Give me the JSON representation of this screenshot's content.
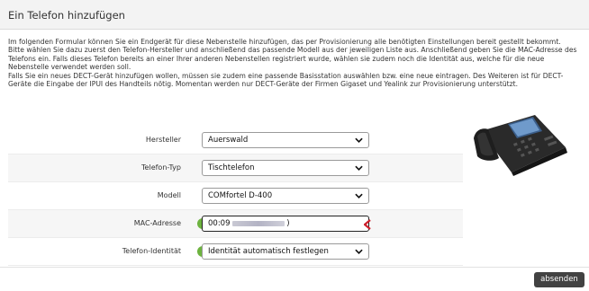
{
  "dialog": {
    "title": "Ein Telefon hinzufügen",
    "intro": [
      "Im folgenden Formular können Sie ein Endgerät für diese Nebenstelle hinzufügen, das per Provisionierung alle benötigten Einstellungen bereit gestellt bekommt.",
      "Bitte wählen Sie dazu zuerst den Telefon-Hersteller und anschließend das passende Modell aus der jeweiligen Liste aus. Anschließend geben Sie die MAC-Adresse des Telefons ein. Falls dieses Telefon bereits an einer Ihrer anderen Nebenstellen registriert wurde, wählen sie zudem noch die Identität aus, welche für die neue Nebenstelle verwendet werden soll.",
      "Falls Sie ein neues DECT-Gerät hinzufügen wollen, müssen sie zudem eine passende Basisstation auswählen bzw. eine neue eintragen. Des Weiteren ist für DECT-Geräte die Eingabe der IPUI des Handteils nötig. Momentan werden nur DECT-Geräte der Firmen Gigaset und Yealink zur Provisionierung unterstützt."
    ]
  },
  "form": {
    "manufacturer": {
      "label": "Hersteller",
      "value": "Auerswald"
    },
    "phone_type": {
      "label": "Telefon-Typ",
      "value": "Tischtelefon"
    },
    "model": {
      "label": "Modell",
      "value": "COMfortel D-400"
    },
    "mac": {
      "label": "MAC-Adresse",
      "value": "00:09"
    },
    "identity": {
      "label": "Telefon-Identität",
      "value": "Identität automatisch festlegen"
    }
  },
  "footer": {
    "submit_label": "absenden"
  },
  "colors": {
    "accent": "#6db33f",
    "button": "#424242",
    "error_marker": "#cc1f2b"
  },
  "icons": {
    "info": "info-icon",
    "dropdown": "chevron-down-icon"
  }
}
